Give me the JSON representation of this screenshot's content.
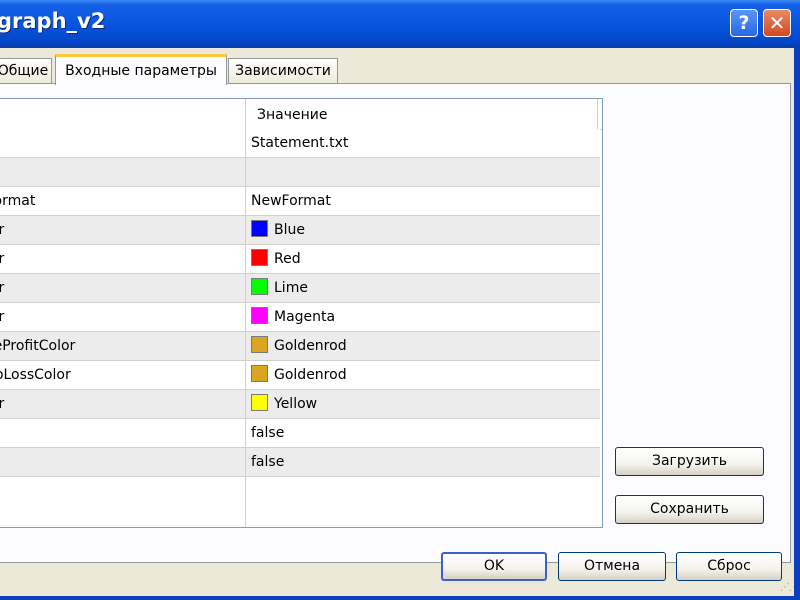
{
  "window": {
    "title": "graph_v2",
    "help_label": "?",
    "close_label": "✕"
  },
  "tabs": [
    {
      "label": "Общие",
      "active": false
    },
    {
      "label": "Входные параметры",
      "active": true
    },
    {
      "label": "Зависимости",
      "active": false
    }
  ],
  "grid": {
    "columns": [
      "",
      "Значение"
    ],
    "rows": [
      {
        "name": "",
        "value": "Statement.txt",
        "color": null
      },
      {
        "name": "",
        "value": "",
        "color": null
      },
      {
        "name": "Format",
        "value": "NewFormat",
        "color": null
      },
      {
        "name": "lor",
        "value": "Blue",
        "color": "#0000ff"
      },
      {
        "name": "lor",
        "value": "Red",
        "color": "#ff0000"
      },
      {
        "name": "lor",
        "value": "Lime",
        "color": "#00ff00"
      },
      {
        "name": "lor",
        "value": "Magenta",
        "color": "#ff00ff"
      },
      {
        "name": "keProfitColor",
        "value": "Goldenrod",
        "color": "#daa520"
      },
      {
        "name": "opLossColor",
        "value": "Goldenrod",
        "color": "#daa520"
      },
      {
        "name": "lor",
        "value": "Yellow",
        "color": "#ffff00"
      },
      {
        "name": "",
        "value": "false",
        "color": null
      },
      {
        "name": "",
        "value": "false",
        "color": null
      }
    ]
  },
  "buttons": {
    "load": "Загрузить",
    "save": "Сохранить",
    "ok": "OK",
    "cancel": "Отмена",
    "reset": "Сброс"
  },
  "colors": {
    "titlebar": "#0a55df",
    "dialog_bg": "#ece9d8",
    "active_tab_accent": "#ffc83c"
  }
}
